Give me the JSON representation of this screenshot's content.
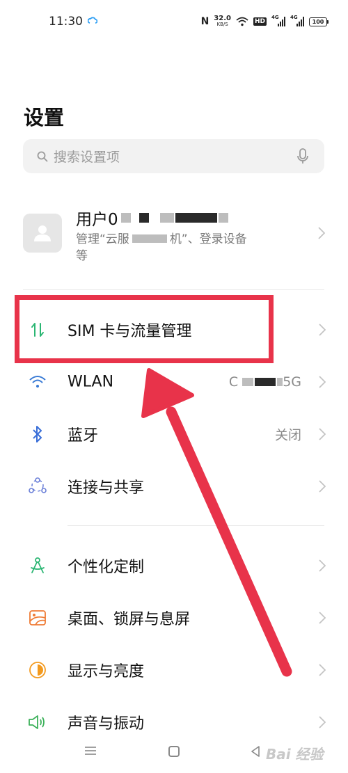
{
  "status_bar": {
    "time": "11:30",
    "nfc": "N",
    "speed_value": "32.0",
    "speed_unit": "KB/S",
    "hd": "HD",
    "network1": "4G",
    "network2": "4G",
    "battery": "100"
  },
  "page_title": "设置",
  "search": {
    "placeholder": "搜索设置项"
  },
  "account": {
    "name": "用户0",
    "desc_prefix": "管理“云服",
    "desc_suffix": "机”、登录设备",
    "desc_line2": "等"
  },
  "items_group1": [
    {
      "name": "sim",
      "label": "SIM 卡与流量管理",
      "value": "",
      "icon": "sim-data-icon",
      "color": "#2bb673"
    },
    {
      "name": "wlan",
      "label": "WLAN",
      "value_prefix": "C",
      "value_suffix": "5G",
      "icon": "wifi-icon",
      "color": "#3a7bd5"
    },
    {
      "name": "bluetooth",
      "label": "蓝牙",
      "value": "关闭",
      "icon": "bluetooth-icon",
      "color": "#3a6fd8"
    },
    {
      "name": "connection",
      "label": "连接与共享",
      "value": "",
      "icon": "connection-share-icon",
      "color": "#6a7fd8"
    }
  ],
  "items_group2": [
    {
      "name": "personalization",
      "label": "个性化定制",
      "value": "",
      "icon": "personalization-icon",
      "color": "#2bb673"
    },
    {
      "name": "desktop",
      "label": "桌面、锁屏与息屏",
      "value": "",
      "icon": "wallpaper-icon",
      "color": "#ef7b35"
    },
    {
      "name": "display",
      "label": "显示与亮度",
      "value": "",
      "icon": "brightness-icon",
      "color": "#f39a1f"
    },
    {
      "name": "sound",
      "label": "声音与振动",
      "value": "",
      "icon": "speaker-icon",
      "color": "#3cb15a"
    }
  ],
  "watermark": "Bai 经验",
  "colors": {
    "highlight": "#e8334a",
    "chevron": "#c4c4c4"
  }
}
